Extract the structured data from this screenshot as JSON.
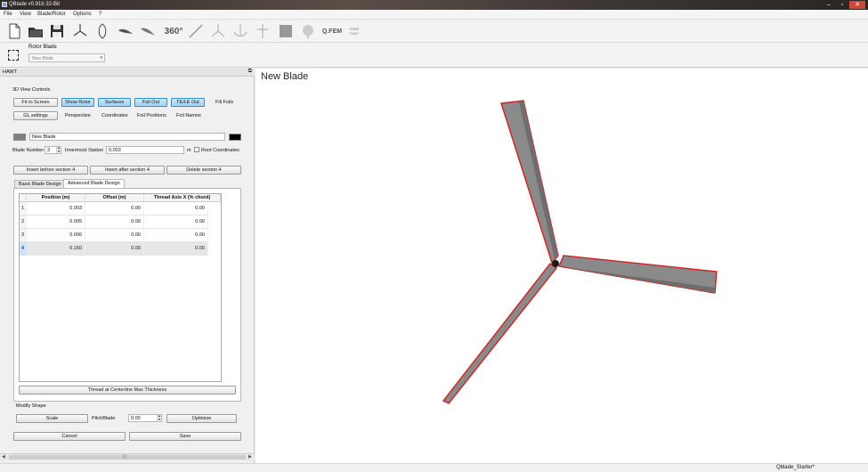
{
  "window": {
    "title": "QBlade v0.91b 32-Bit"
  },
  "menu": [
    "File",
    "View",
    "Blade/Rotor",
    "Options",
    "?"
  ],
  "toolbar": {
    "angle_label": "360°",
    "qfem_label": "Q.FEM",
    "free_label": "FREE",
    "fast_label": "FAST"
  },
  "rotor_blade": {
    "label": "Rotor Blade",
    "selected": "New Blade"
  },
  "panel": {
    "title": "HAWT",
    "view_controls_title": "3D View Controls",
    "buttons_row1": [
      {
        "label": "Fit to Screen",
        "active": false
      },
      {
        "label": "Show Rotor",
        "active": true
      },
      {
        "label": "Surfaces",
        "active": true
      },
      {
        "label": "Foil Out",
        "active": true
      },
      {
        "label": "TE/LE Out",
        "active": true
      }
    ],
    "fill_foils_label": "Fill Foils",
    "gl_settings_label": "GL settings",
    "row2_labels": [
      "Perspective",
      "Coordinates",
      "Foil Positions",
      "Foil Names"
    ],
    "blade_name": "New Blade",
    "blade_color": "#808080",
    "blade_color2": "#000000",
    "blade_number_label": "Blade Number",
    "blade_number": "3",
    "innermost_label": "Innermost Station",
    "innermost_value": "0.003",
    "innermost_unit": "m",
    "root_coords_label": "Root Coordinates",
    "insert_before": "Insert before section 4",
    "insert_after": "Insert after section 4",
    "delete_section": "Delete section 4",
    "tabs": [
      {
        "label": "Basic Blade Design",
        "active": false
      },
      {
        "label": "Advanced Blade Design",
        "active": true
      }
    ],
    "table": {
      "headers": [
        "Position (m)",
        "Offset (m)",
        "Thread Axis X (% chord)"
      ],
      "rows": [
        {
          "id": "1",
          "position": "0.003",
          "offset": "0.00",
          "thread": "0.00"
        },
        {
          "id": "2",
          "position": "0.005",
          "offset": "0.00",
          "thread": "0.00"
        },
        {
          "id": "3",
          "position": "0.006",
          "offset": "0.00",
          "thread": "0.00"
        },
        {
          "id": "4",
          "position": "0.150",
          "offset": "0.00",
          "thread": "0.00"
        }
      ]
    },
    "thread_button": "Thread at Centerline  Max Thickness",
    "modify_shape_title": "Modify Shape",
    "scale_label": "Scale",
    "pitch_label": "PitchBlade",
    "pitch_value": "0.00",
    "optimize_label": "Optimize",
    "cancel_label": "Cancel",
    "save_label": "Save",
    "scroll_mid": "|||"
  },
  "viewport": {
    "title": "New Blade",
    "blade_fill": "#8a8a8a",
    "edge_color": "#d42020"
  },
  "status": {
    "text": "Qblade_Starter*"
  }
}
